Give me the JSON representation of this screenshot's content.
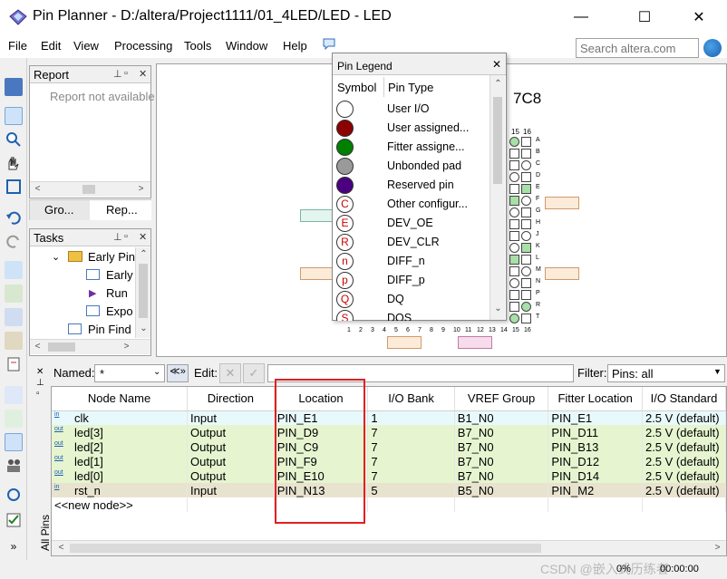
{
  "window": {
    "title": "Pin Planner - D:/altera/Project1111/01_4LED/LED - LED",
    "minimize": "—",
    "maximize": "☐",
    "close": "✕"
  },
  "menu": [
    "File",
    "Edit",
    "View",
    "Processing",
    "Tools",
    "Window",
    "Help"
  ],
  "search": {
    "placeholder": "Search altera.com"
  },
  "report": {
    "title": "Report",
    "message": "Report not available",
    "tabs": [
      "Gro...",
      "Rep..."
    ]
  },
  "tasks": {
    "title": "Tasks",
    "items": [
      "Early Pin",
      "Early",
      "Run",
      "Expo",
      "Pin Find"
    ]
  },
  "chip": {
    "device_suffix": "7C8",
    "col_numbers_top": [
      "15",
      "16"
    ],
    "row_letters": [
      "A",
      "B",
      "C",
      "D",
      "E",
      "F",
      "G",
      "H",
      "J",
      "K",
      "L",
      "M",
      "N",
      "P",
      "R",
      "T"
    ],
    "col_numbers_bottom": [
      "1",
      "2",
      "3",
      "4",
      "5",
      "6",
      "7",
      "8",
      "9",
      "10",
      "11",
      "12",
      "13",
      "14",
      "15",
      "16"
    ]
  },
  "legend": {
    "title": "Pin Legend",
    "col_symbol": "Symbol",
    "col_type": "Pin Type",
    "rows": [
      {
        "label": "User I/O",
        "fill": "#ffffff",
        "letter": ""
      },
      {
        "label": "User assigned...",
        "fill": "#8b0000",
        "letter": ""
      },
      {
        "label": "Fitter assigne...",
        "fill": "#008000",
        "letter": ""
      },
      {
        "label": "Unbonded pad",
        "fill": "#9a9a9a",
        "letter": ""
      },
      {
        "label": "Reserved pin",
        "fill": "#4b0082",
        "letter": ""
      },
      {
        "label": "Other configur...",
        "fill": "#ffffff",
        "letter": "C"
      },
      {
        "label": "DEV_OE",
        "fill": "#ffffff",
        "letter": "E"
      },
      {
        "label": "DEV_CLR",
        "fill": "#ffffff",
        "letter": "R"
      },
      {
        "label": "DIFF_n",
        "fill": "#ffffff",
        "letter": "n"
      },
      {
        "label": "DIFF_p",
        "fill": "#ffffff",
        "letter": "p"
      },
      {
        "label": "DQ",
        "fill": "#ffffff",
        "letter": "Q"
      },
      {
        "label": "DQS",
        "fill": "#ffffff",
        "letter": "S"
      }
    ]
  },
  "filter": {
    "named_label": "Named:",
    "named_value": "*",
    "edit_label": "Edit:",
    "filter_label": "Filter:",
    "filter_value": "Pins: all"
  },
  "table": {
    "columns": [
      "Node Name",
      "Direction",
      "Location",
      "I/O Bank",
      "VREF Group",
      "Fitter Location",
      "I/O Standard"
    ],
    "rows": [
      {
        "icon": "in",
        "name": "clk",
        "direction": "Input",
        "location": "PIN_E1",
        "bank": "1",
        "vref": "B1_N0",
        "fitter": "PIN_E1",
        "std": "2.5 V (default)"
      },
      {
        "icon": "out",
        "name": "led[3]",
        "direction": "Output",
        "location": "PIN_D9",
        "bank": "7",
        "vref": "B7_N0",
        "fitter": "PIN_D11",
        "std": "2.5 V (default)"
      },
      {
        "icon": "out",
        "name": "led[2]",
        "direction": "Output",
        "location": "PIN_C9",
        "bank": "7",
        "vref": "B7_N0",
        "fitter": "PIN_B13",
        "std": "2.5 V (default)"
      },
      {
        "icon": "out",
        "name": "led[1]",
        "direction": "Output",
        "location": "PIN_F9",
        "bank": "7",
        "vref": "B7_N0",
        "fitter": "PIN_D12",
        "std": "2.5 V (default)"
      },
      {
        "icon": "out",
        "name": "led[0]",
        "direction": "Output",
        "location": "PIN_E10",
        "bank": "7",
        "vref": "B7_N0",
        "fitter": "PIN_D14",
        "std": "2.5 V (default)"
      },
      {
        "icon": "in",
        "name": "rst_n",
        "direction": "Input",
        "location": "PIN_N13",
        "bank": "5",
        "vref": "B5_N0",
        "fitter": "PIN_M2",
        "std": "2.5 V (default)"
      }
    ],
    "new_node": "<<new node>>"
  },
  "side_tab": "All Pins",
  "status": {
    "progress": "0%",
    "time": "00:00:00"
  },
  "watermark": "CSDN @嵌入式历练者",
  "colors": {
    "highlight_box": "#e02020",
    "input_row": "#e8f9fb",
    "output_row": "#e6f5d0",
    "selected_row": "#e8e3cf"
  }
}
